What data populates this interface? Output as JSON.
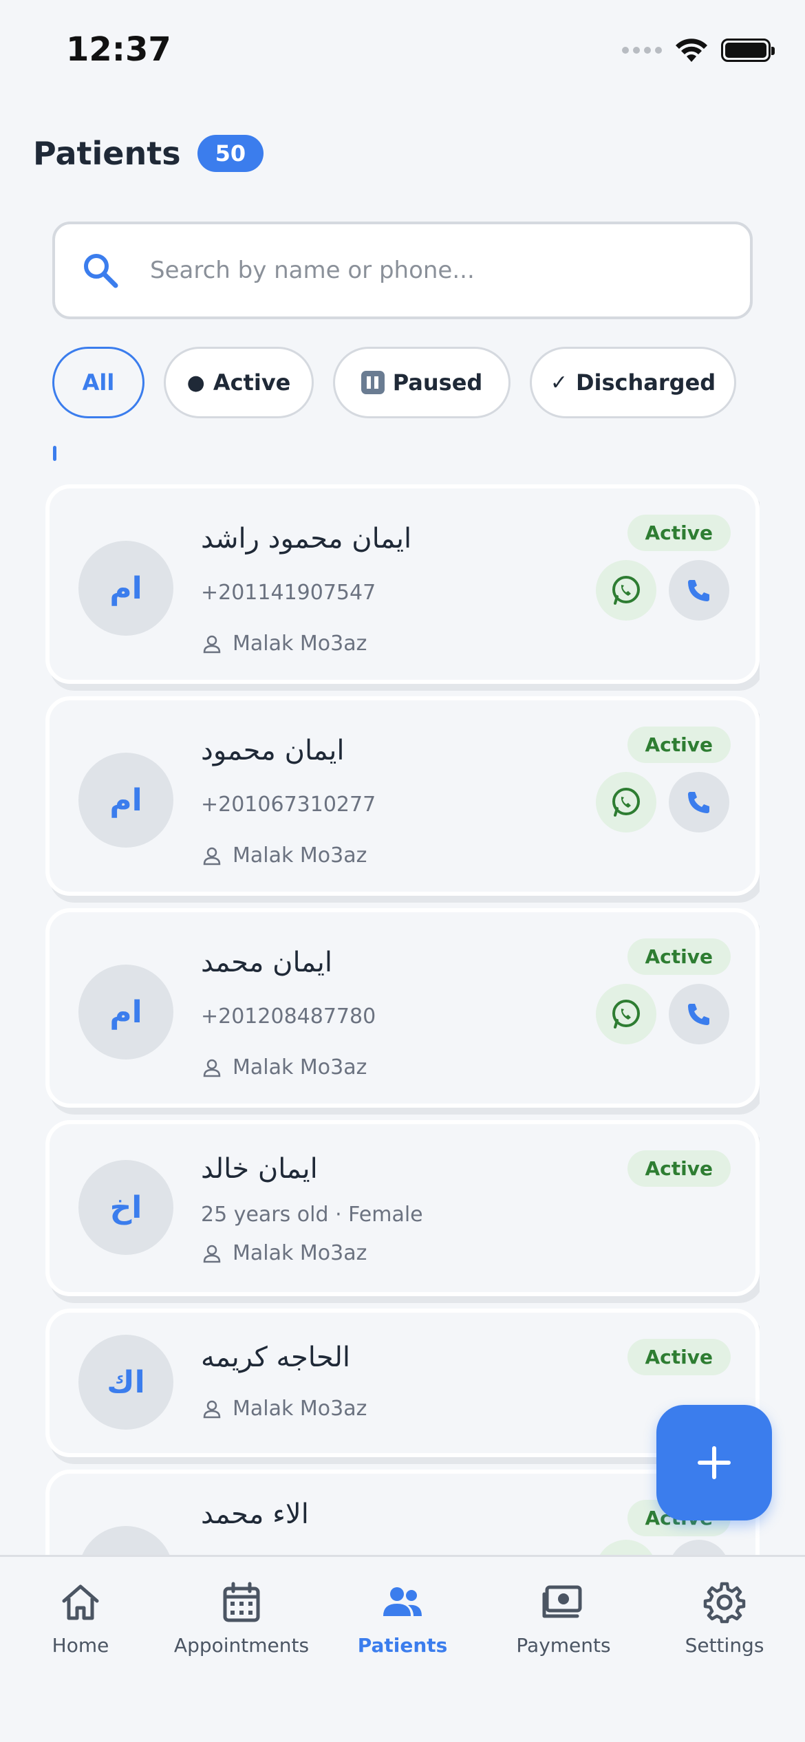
{
  "status_bar": {
    "time": "12:37"
  },
  "header": {
    "title": "Patients",
    "count": "50"
  },
  "search": {
    "placeholder": "Search by name or phone..."
  },
  "filters": [
    {
      "label": "All",
      "icon": ""
    },
    {
      "label": "Active",
      "icon": "●"
    },
    {
      "label": "Paused",
      "icon": "pause-icon"
    },
    {
      "label": "Discharged",
      "icon": "✓"
    }
  ],
  "colors": {
    "accent": "#3b7ded",
    "active_green": "#2e7d32",
    "active_bg": "#e3f1e4"
  },
  "patients": [
    {
      "initials": "ام",
      "name": "ايمان محمود راشد",
      "phone": "+201141907547",
      "doctor": "Malak Mo3az",
      "status": "Active"
    },
    {
      "initials": "ام",
      "name": "ايمان محمود",
      "phone": "+201067310277",
      "doctor": "Malak Mo3az",
      "status": "Active"
    },
    {
      "initials": "ام",
      "name": "ايمان محمد",
      "phone": "+201208487780",
      "doctor": "Malak Mo3az",
      "status": "Active"
    },
    {
      "initials": "اخ",
      "name": "ايمان خالد",
      "details": "25 years old · Female",
      "doctor": "Malak Mo3az",
      "status": "Active"
    },
    {
      "initials": "اك",
      "name": "الحاجه كريمه",
      "doctor": "Malak Mo3az",
      "status": "Active"
    },
    {
      "initials": "",
      "name": "الاء محمد",
      "status": "Active"
    }
  ],
  "nav": [
    {
      "label": "Home",
      "icon": "home-icon"
    },
    {
      "label": "Appointments",
      "icon": "calendar-icon"
    },
    {
      "label": "Patients",
      "icon": "people-icon"
    },
    {
      "label": "Payments",
      "icon": "payments-icon"
    },
    {
      "label": "Settings",
      "icon": "gear-icon"
    }
  ]
}
